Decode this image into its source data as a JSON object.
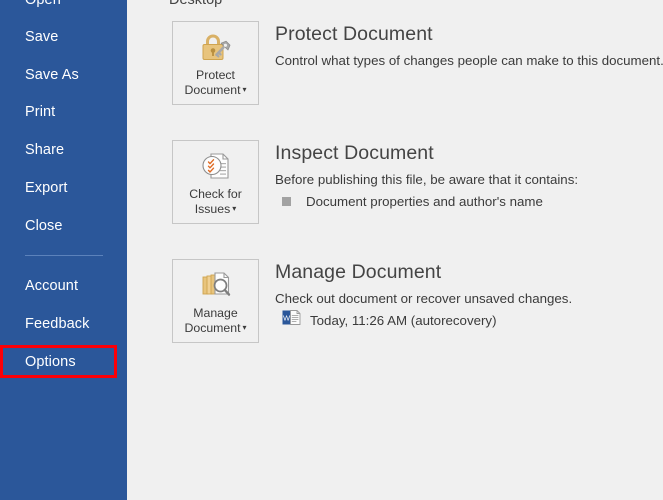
{
  "app": {
    "accent_blue": "#2b579a",
    "pane_bg": "#f0f0f0",
    "highlight_red": "#fb0007"
  },
  "sidebar": {
    "items": [
      {
        "label": "Open",
        "name": "open"
      },
      {
        "label": "Save",
        "name": "save"
      },
      {
        "label": "Save As",
        "name": "save-as"
      },
      {
        "label": "Print",
        "name": "print"
      },
      {
        "label": "Share",
        "name": "share"
      },
      {
        "label": "Export",
        "name": "export"
      },
      {
        "label": "Close",
        "name": "close"
      },
      {
        "label": "Account",
        "name": "account"
      },
      {
        "label": "Feedback",
        "name": "feedback"
      },
      {
        "label": "Options",
        "name": "options"
      }
    ]
  },
  "main": {
    "breadcrumb": "Desktop",
    "sections": [
      {
        "key": "protect",
        "button_label_line1": "Protect",
        "button_label_line2": "Document",
        "button_caret": "▾",
        "title": "Protect Document",
        "description": "Control what types of changes people can make to this document.",
        "icon": "padlock-key-icon"
      },
      {
        "key": "inspect",
        "button_label_line1": "Check for",
        "button_label_line2": "Issues",
        "button_caret": "▾",
        "title": "Inspect Document",
        "description": "Before publishing this file, be aware that it contains:",
        "bullet": "Document properties and author's name",
        "icon": "document-check-icon"
      },
      {
        "key": "manage",
        "button_label_line1": "Manage",
        "button_label_line2": "Document",
        "button_caret": "▾",
        "title": "Manage Document",
        "description": "Check out document or recover unsaved changes.",
        "recovery_item": "Today, 11:26 AM (autorecovery)",
        "icon": "documents-magnifier-icon",
        "recovery_icon": "word-document-icon"
      }
    ]
  }
}
